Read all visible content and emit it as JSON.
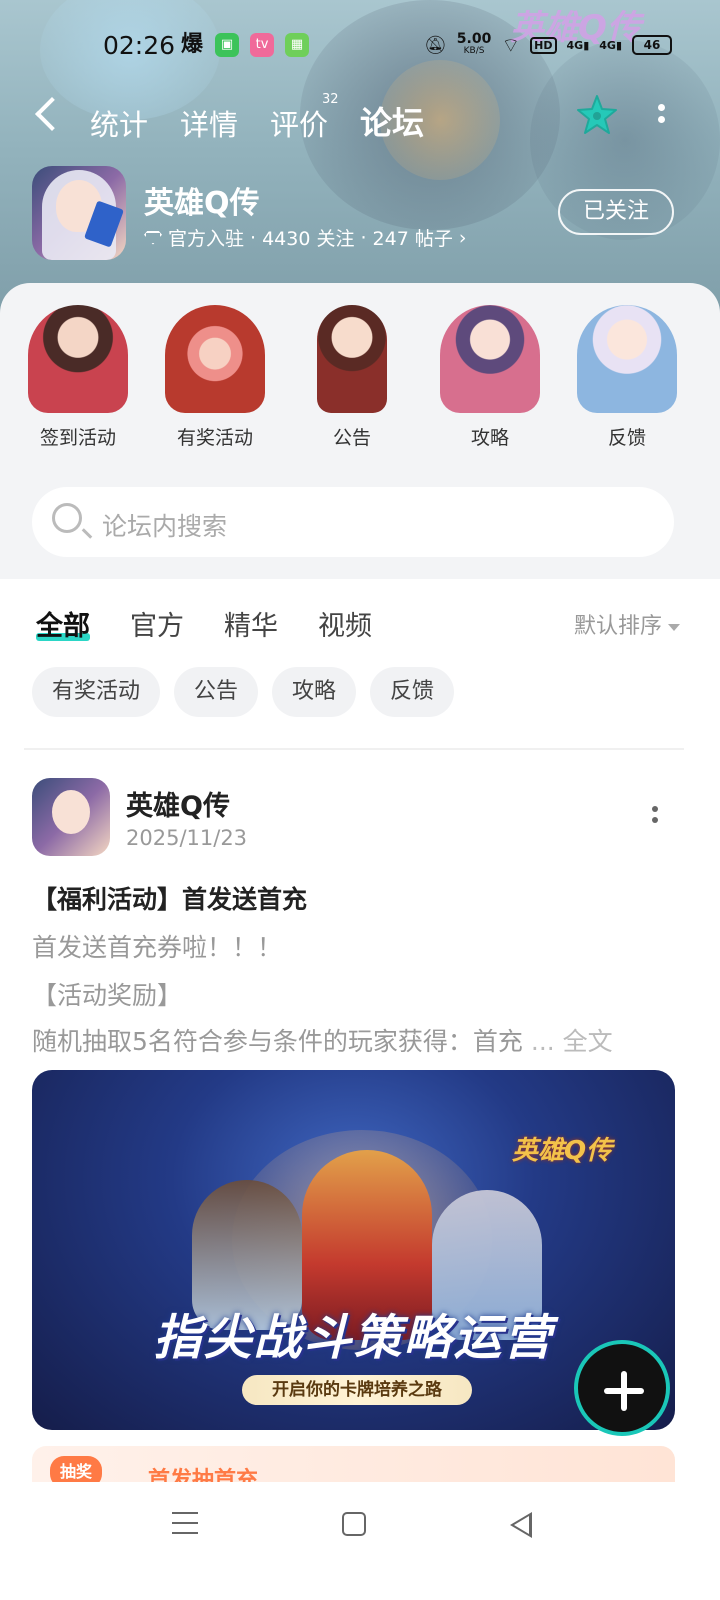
{
  "status_bar": {
    "time": "02:26",
    "net_speed": "5.00",
    "net_unit": "KB/S",
    "hd": "HD",
    "sig1": "4G",
    "sig2": "4G",
    "battery": "46",
    "explode_glyph": "爆"
  },
  "header": {
    "tabs": [
      {
        "label": "统计"
      },
      {
        "label": "详情"
      },
      {
        "label": "评价"
      },
      {
        "label": "论坛"
      }
    ],
    "review_count": "32",
    "watermark_logo": "英雄Q传"
  },
  "game": {
    "name": "英雄Q传",
    "official": "官方入驻",
    "followers": "4430 关注",
    "posts": "247 帖子",
    "follow_button": "已关注"
  },
  "categories": [
    {
      "label": "签到活动",
      "color": "#c9434f"
    },
    {
      "label": "有奖活动",
      "color": "#b83a2e"
    },
    {
      "label": "公告",
      "color": "#8a2f2a"
    },
    {
      "label": "攻略",
      "color": "#d76f8e"
    },
    {
      "label": "反馈",
      "color": "#8db6e0"
    }
  ],
  "search": {
    "placeholder": "论坛内搜索"
  },
  "filter_tabs": [
    {
      "label": "全部"
    },
    {
      "label": "官方"
    },
    {
      "label": "精华"
    },
    {
      "label": "视频"
    }
  ],
  "sort": "默认排序",
  "chips": [
    {
      "label": "有奖活动"
    },
    {
      "label": "公告"
    },
    {
      "label": "攻略"
    },
    {
      "label": "反馈"
    }
  ],
  "post": {
    "author": "英雄Q传",
    "date": "2025/11/23",
    "title": "【福利活动】首发送首充",
    "line1": "首发送首充券啦！！！",
    "line2": "【活动奖励】",
    "line3": "随机抽取5名符合参与条件的玩家获得：首充",
    "ellipsis": " ...",
    "full_text": " 全文",
    "banner_logo": "英雄Q传",
    "banner_slogan": "指尖战斗策略运营",
    "banner_sub": "开启你的卡牌培养之路"
  },
  "reward": {
    "tag": "抽奖",
    "text": "首发抽首充"
  },
  "colors": {
    "accent": "#2bd6c6",
    "orange": "#ff7a45"
  }
}
